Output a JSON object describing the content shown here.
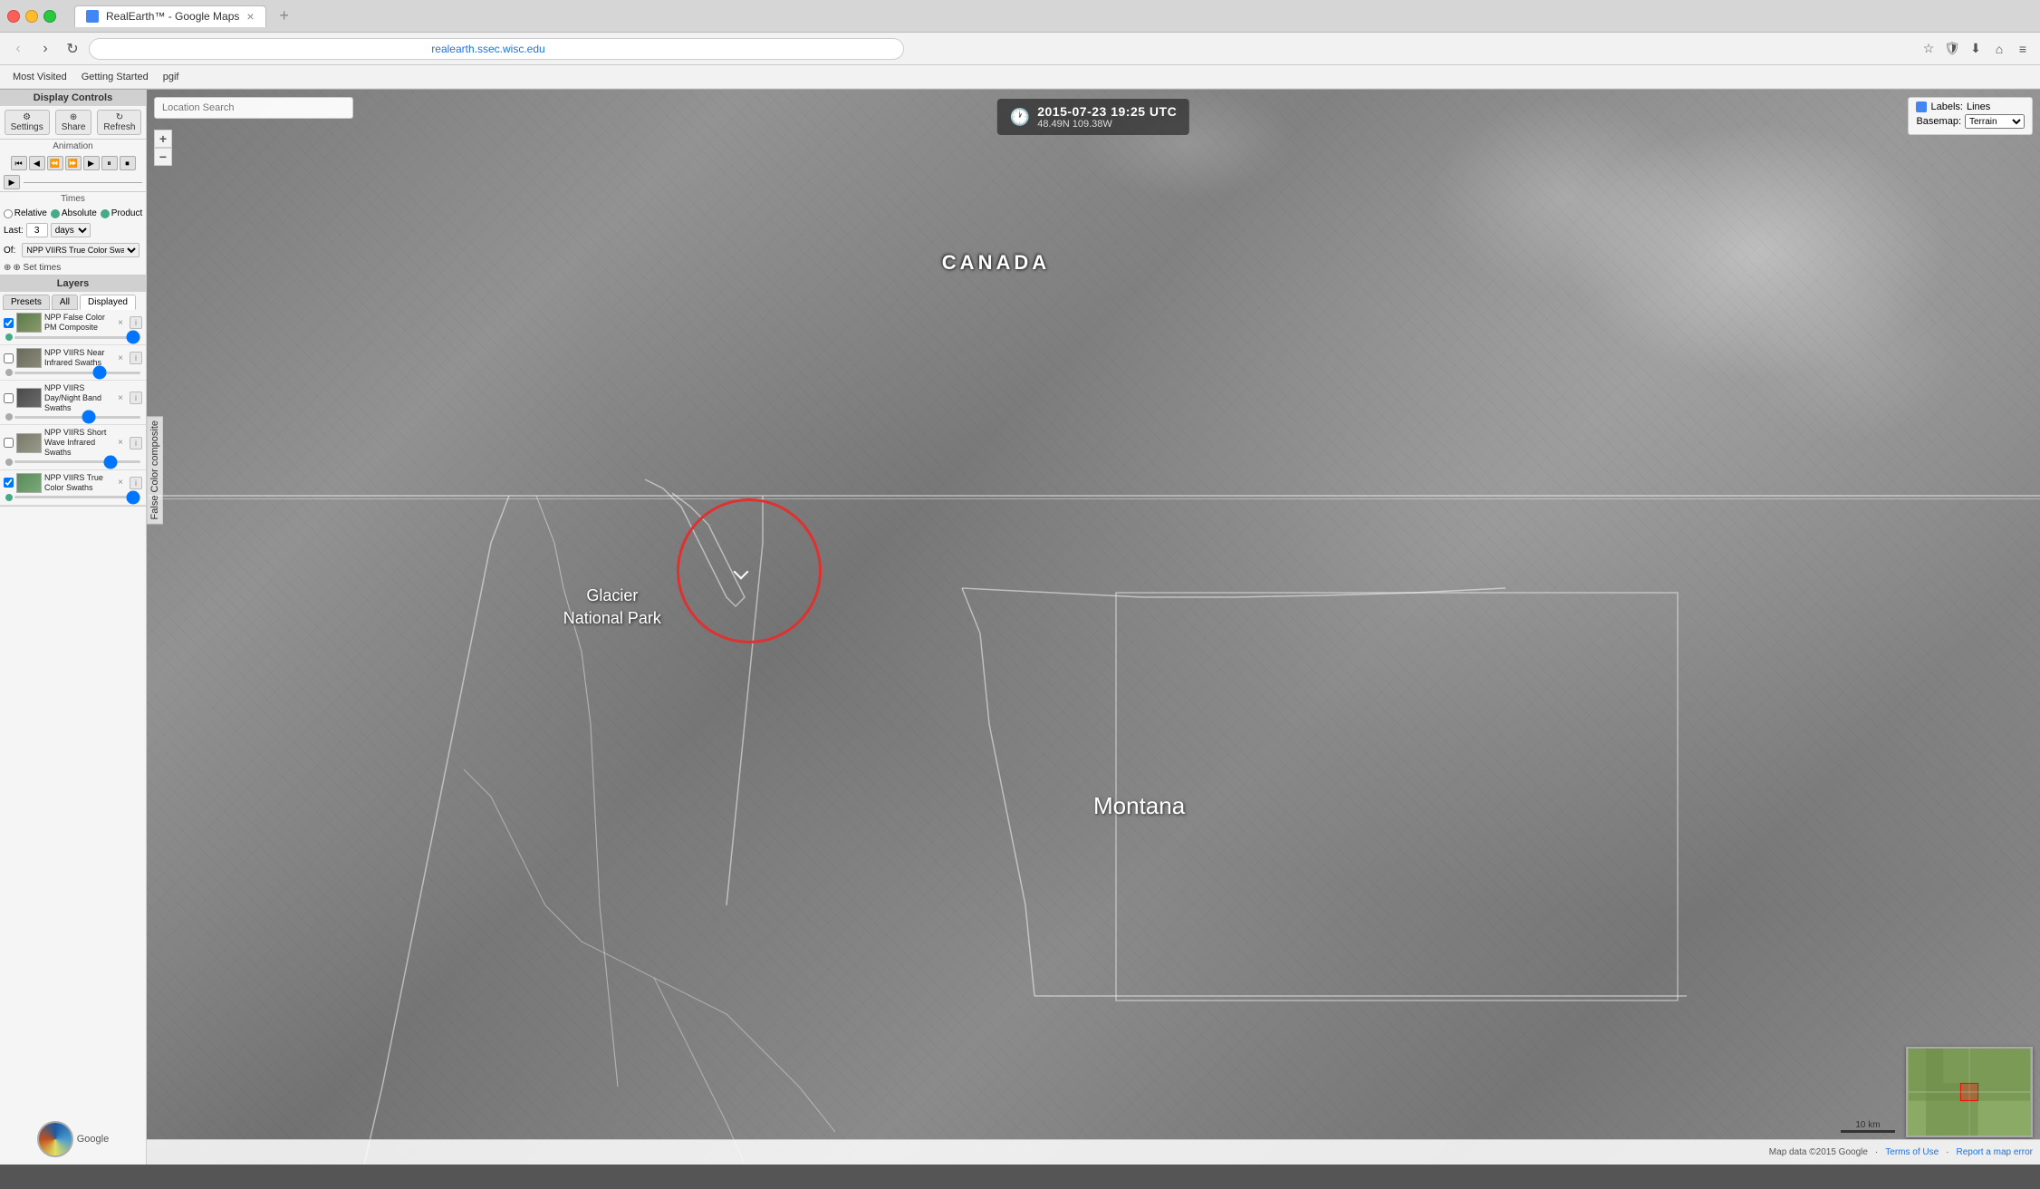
{
  "browser": {
    "title": "RealEarth™ - Google Maps",
    "url": "realearth.ssec.wisc.edu",
    "tab_label": "RealEarth™ - Google Maps",
    "new_tab_label": "+",
    "back_label": "‹",
    "forward_label": "›",
    "refresh_label": "↻",
    "bookmarks": [
      {
        "label": "Most Visited"
      },
      {
        "label": "Getting Started"
      },
      {
        "label": "pgif"
      }
    ]
  },
  "location_search": {
    "placeholder": "Location Search"
  },
  "timestamp": {
    "date": "2015-07-23 19:25 UTC",
    "coords": "48.49N 109.38W"
  },
  "labels_panel": {
    "labels_label": "Labels:",
    "lines_label": "Lines",
    "basemap_label": "Basemap:",
    "terrain_label": "Terrain"
  },
  "display_controls": {
    "title": "Display Controls",
    "settings_label": "⚙ Settings",
    "share_label": "⊕ Share",
    "refresh_label": "↻ Refresh"
  },
  "animation": {
    "title": "Animation",
    "buttons": [
      "⏮",
      "⏭",
      "⏪",
      "⏩",
      "▶",
      "⏸",
      "⏹"
    ]
  },
  "times": {
    "title": "Times",
    "relative_label": "Relative",
    "absolute_label": "Absolute",
    "product_label": "Product",
    "last_label": "Last:",
    "last_value": "3",
    "days_label": "days",
    "of_label": "Of:",
    "product_value": "NPP VIIRS True Color Swath",
    "set_times_label": "⊕ Set times"
  },
  "layers": {
    "title": "Layers",
    "tabs": [
      "Presets",
      "All",
      "Displayed"
    ],
    "items": [
      {
        "id": "layer1",
        "label": "NPP False Color PM Composite",
        "checked": true,
        "thumb_color": "#5a7a4a"
      },
      {
        "id": "layer2",
        "label": "NPP VIIRS Near Infrared Swaths",
        "checked": false,
        "thumb_color": "#6a6a5a"
      },
      {
        "id": "layer3",
        "label": "NPP VIIRS Day/Night Band Swaths",
        "checked": false,
        "thumb_color": "#4a4a4a"
      },
      {
        "id": "layer4",
        "label": "NPP VIIRS Short Wave Infrared Swaths",
        "checked": false,
        "thumb_color": "#7a7a6a"
      },
      {
        "id": "layer5",
        "label": "NPP VIIRS True Color Swaths",
        "checked": true,
        "thumb_color": "#5a8a5a"
      }
    ]
  },
  "map": {
    "canada_label": "CANADA",
    "montana_label": "Montana",
    "glacier_label": "Glacier\nNational Park",
    "false_color_label": "False Color composite"
  },
  "footer": {
    "map_data": "Map data ©2015 Google",
    "terms": "Terms of Use",
    "report": "Report a map error",
    "scale": "10 km"
  }
}
